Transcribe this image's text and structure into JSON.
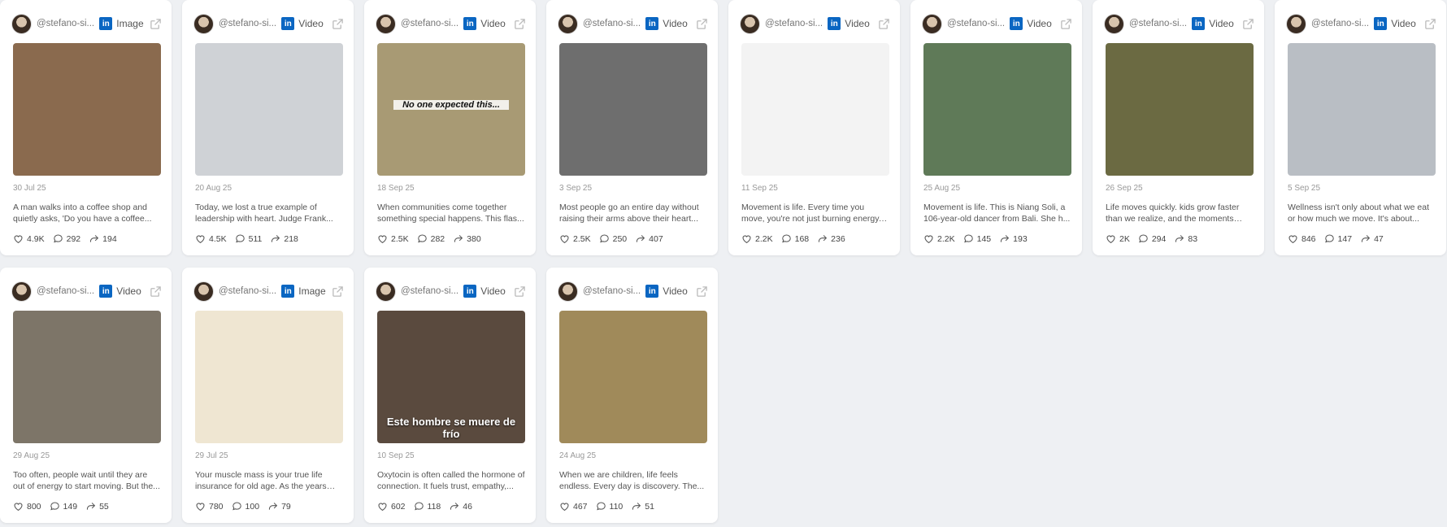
{
  "cards": [
    {
      "handle": "@stefano-si...",
      "type": "Image",
      "date": "30 Jul 25",
      "desc": "A man walks into a coffee shop and quietly asks, 'Do you have a coffee...",
      "likes": "4.9K",
      "comments": "292",
      "shares": "194",
      "thumb_text": "",
      "thumb_bg": "#8a6a4e"
    },
    {
      "handle": "@stefano-si...",
      "type": "Video",
      "date": "20 Aug 25",
      "desc": "Today, we lost a true example of leadership with heart. Judge Frank...",
      "likes": "4.5K",
      "comments": "511",
      "shares": "218",
      "thumb_text": "",
      "thumb_bg": "#cfd2d6"
    },
    {
      "handle": "@stefano-si...",
      "type": "Video",
      "date": "18 Sep 25",
      "desc": "When communities come together something special happens. This flas...",
      "likes": "2.5K",
      "comments": "282",
      "shares": "380",
      "thumb_text": "No one expected this...",
      "thumb_bg": "#a89a74"
    },
    {
      "handle": "@stefano-si...",
      "type": "Video",
      "date": "3 Sep 25",
      "desc": "Most people go an entire day without raising their arms above their heart...",
      "likes": "2.5K",
      "comments": "250",
      "shares": "407",
      "thumb_text": "",
      "thumb_bg": "#6e6e6e"
    },
    {
      "handle": "@stefano-si...",
      "type": "Video",
      "date": "11 Sep 25",
      "desc": "Movement is life. Every time you move, you're not just burning energy, you're...",
      "likes": "2.2K",
      "comments": "168",
      "shares": "236",
      "thumb_text": "",
      "thumb_bg": "#f3f3f3"
    },
    {
      "handle": "@stefano-si...",
      "type": "Video",
      "date": "25 Aug 25",
      "desc": "Movement is life. This is Niang Soli, a 106-year-old dancer from Bali. She h...",
      "likes": "2.2K",
      "comments": "145",
      "shares": "193",
      "thumb_text": "",
      "thumb_bg": "#5f7a58"
    },
    {
      "handle": "@stefano-si...",
      "type": "Video",
      "date": "26 Sep 25",
      "desc": "Life moves quickly. kids grow faster than we realize, and the moments we...",
      "likes": "2K",
      "comments": "294",
      "shares": "83",
      "thumb_text": "",
      "thumb_bg": "#6b6a42"
    },
    {
      "handle": "@stefano-si...",
      "type": "Video",
      "date": "5 Sep 25",
      "desc": "Wellness isn't only about what we eat or how much we move. It's about...",
      "likes": "846",
      "comments": "147",
      "shares": "47",
      "thumb_text": "",
      "thumb_bg": "#b9bec4"
    },
    {
      "handle": "@stefano-si...",
      "type": "Video",
      "date": "29 Aug 25",
      "desc": "Too often, people wait until they are out of energy to start moving. But the...",
      "likes": "800",
      "comments": "149",
      "shares": "55",
      "thumb_text": "",
      "thumb_bg": "#7d7568"
    },
    {
      "handle": "@stefano-si...",
      "type": "Image",
      "date": "29 Jul 25",
      "desc": "Your muscle mass is your true life insurance for old age. As the years go...",
      "likes": "780",
      "comments": "100",
      "shares": "79",
      "thumb_text": "",
      "thumb_bg": "#efe6d2"
    },
    {
      "handle": "@stefano-si...",
      "type": "Video",
      "date": "10 Sep 25",
      "desc": "Oxytocin is often called the hormone of connection. It fuels trust, empathy,...",
      "likes": "602",
      "comments": "118",
      "shares": "46",
      "thumb_text": "Este hombre se muere de frío",
      "thumb_bg": "#5a4a3e"
    },
    {
      "handle": "@stefano-si...",
      "type": "Video",
      "date": "24 Aug 25",
      "desc": "When we are children, life feels endless. Every day is discovery. The...",
      "likes": "467",
      "comments": "110",
      "shares": "51",
      "thumb_text": "",
      "thumb_bg": "#a08a5a"
    }
  ],
  "colors": {
    "linkedin": "#0a66c2",
    "background": "#eef0f3"
  }
}
